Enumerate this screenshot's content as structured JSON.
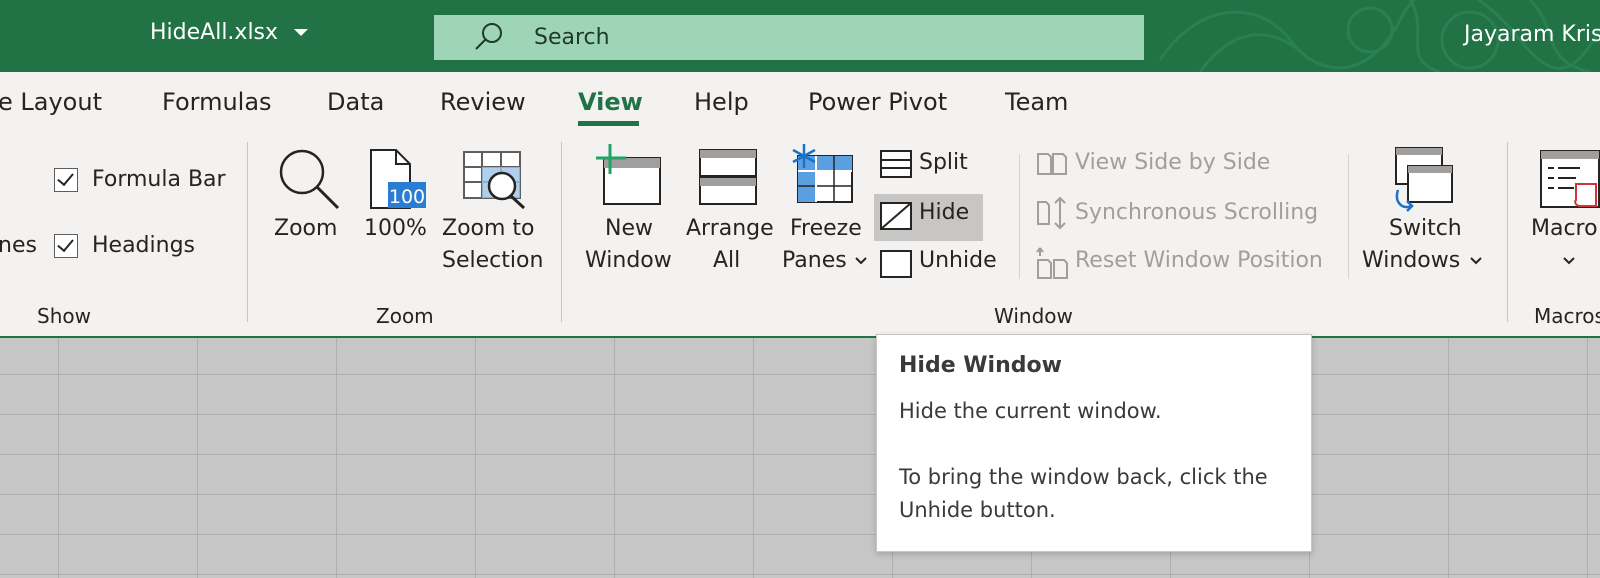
{
  "title_bar": {
    "filename": "HideAll.xlsx",
    "search_placeholder": "Search",
    "user_name": "Jayaram Kris",
    "color": "#217346"
  },
  "tabs": [
    {
      "label": "e Layout"
    },
    {
      "label": "Formulas"
    },
    {
      "label": "Data"
    },
    {
      "label": "Review"
    },
    {
      "label": "View",
      "active": true
    },
    {
      "label": "Help"
    },
    {
      "label": "Power Pivot"
    },
    {
      "label": "Team"
    }
  ],
  "ribbon": {
    "show": {
      "formula_bar": "Formula Bar",
      "gridlines_partial": "nes",
      "headings": "Headings",
      "group_label": "Show"
    },
    "zoom": {
      "zoom": "Zoom",
      "hundred": "100%",
      "hundred_icon_text": "100",
      "zoom_to": "Zoom to",
      "selection": "Selection",
      "group_label": "Zoom"
    },
    "window": {
      "new": "New",
      "new_window": "Window",
      "arrange": "Arrange",
      "arrange_all": "All",
      "freeze": "Freeze",
      "freeze_panes": "Panes",
      "split": "Split",
      "hide": "Hide",
      "unhide": "Unhide",
      "view_side_by_side": "View Side by Side",
      "synchronous_scrolling": "Synchronous Scrolling",
      "reset_window_position": "Reset Window Position",
      "switch": "Switch",
      "switch_windows": "Windows",
      "group_label": "Window"
    },
    "macros": {
      "macros_partial": "Macro",
      "group_label_partial": "Macros"
    }
  },
  "tooltip": {
    "title": "Hide Window",
    "line1": "Hide the current window.",
    "line2": "To bring the window back, click the",
    "line3": "Unhide button."
  }
}
